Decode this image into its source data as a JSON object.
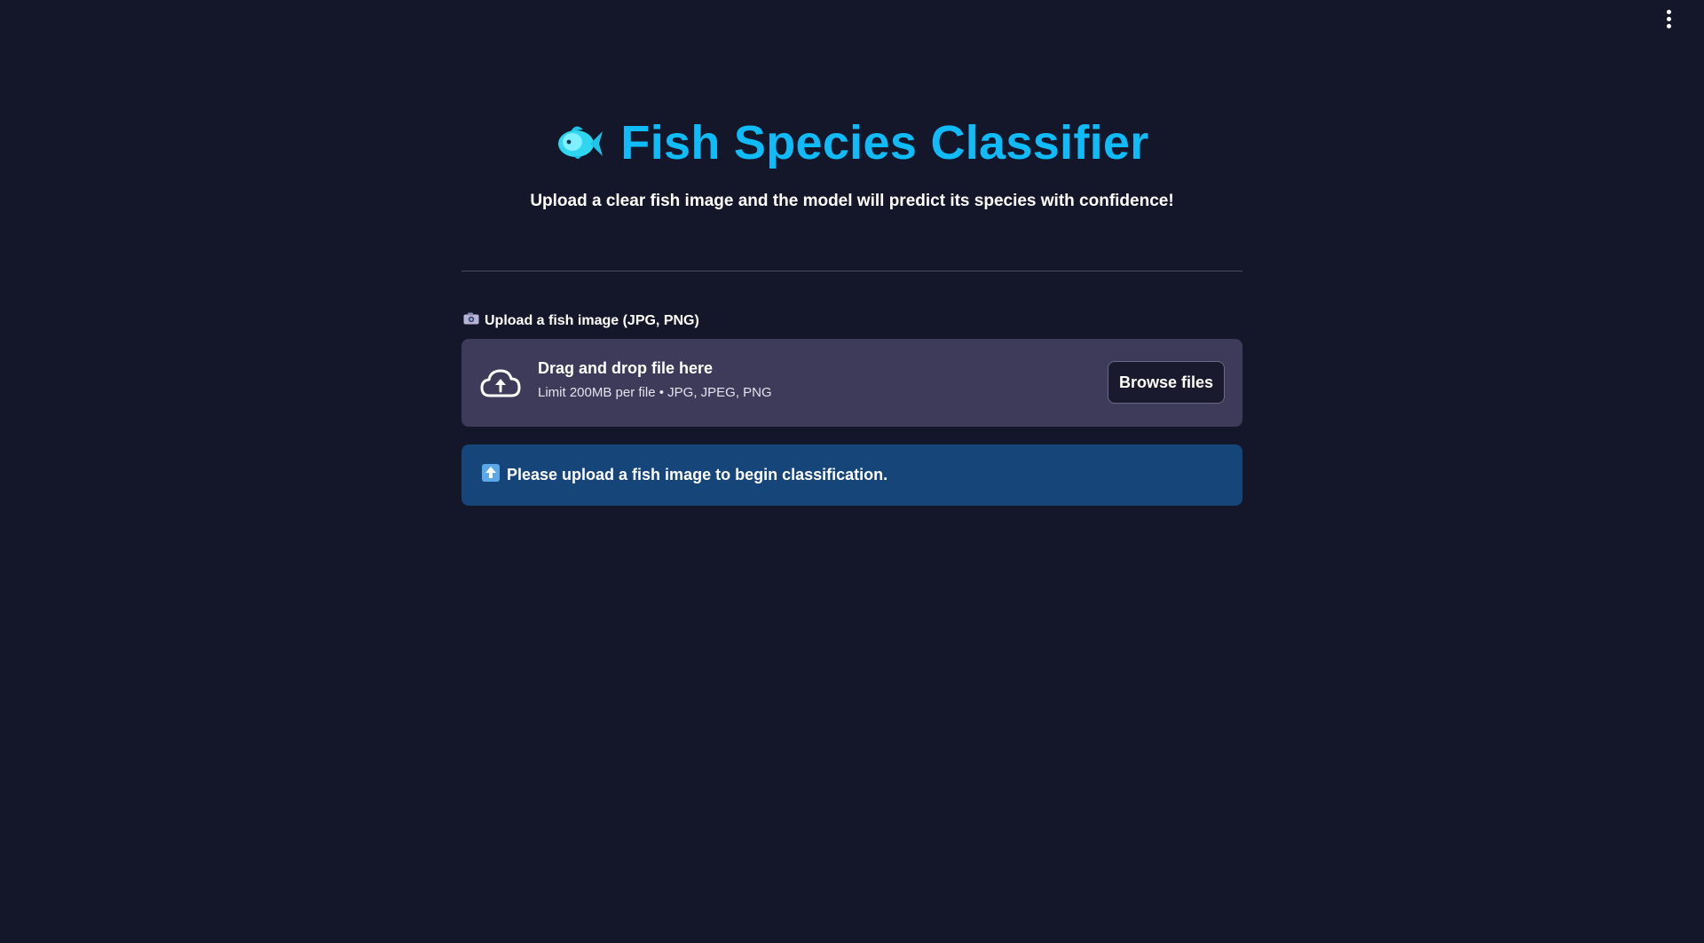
{
  "header": {
    "menu_icon": "vertical-dots-icon"
  },
  "main": {
    "title_icon": "fish-icon",
    "title": "Fish Species Classifier",
    "subtitle": "Upload a clear fish image and the model will predict its species with confidence!",
    "accent_color": "#0fbcf9"
  },
  "uploader": {
    "label_icon": "camera-icon",
    "label": "Upload a fish image (JPG, PNG)",
    "dropzone_icon": "cloud-upload-icon",
    "dropzone_title": "Drag and drop file here",
    "dropzone_limit": "Limit 200MB per file • JPG, JPEG, PNG",
    "browse_label": "Browse files"
  },
  "info": {
    "icon": "up-arrow-icon",
    "message": "Please upload a fish image to begin classification.",
    "background_color": "#16457a"
  }
}
